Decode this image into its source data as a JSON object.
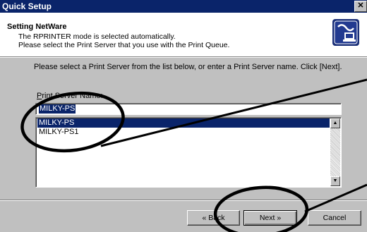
{
  "window": {
    "title": "Quick Setup",
    "close_label": "✕"
  },
  "header": {
    "title": "Setting NetWare",
    "line1": "The RPRINTER mode is selected automatically.",
    "line2": "Please select the Print Server that you use with the Print Queue.",
    "icon": "printer-network-icon"
  },
  "main": {
    "instruction": "Please select a Print Server from the list below, or enter a Print Server name. Click [Next].",
    "field_label_first": "P",
    "field_label_rest": "rint Server Name:",
    "field_value": "MILKY-PS",
    "list_items": [
      "MILKY-PS",
      "MILKY-PS1"
    ],
    "selected_index": 0
  },
  "buttons": {
    "back": "« Back",
    "next": "Next »",
    "cancel": "Cancel"
  },
  "annotation_color": "#000000"
}
